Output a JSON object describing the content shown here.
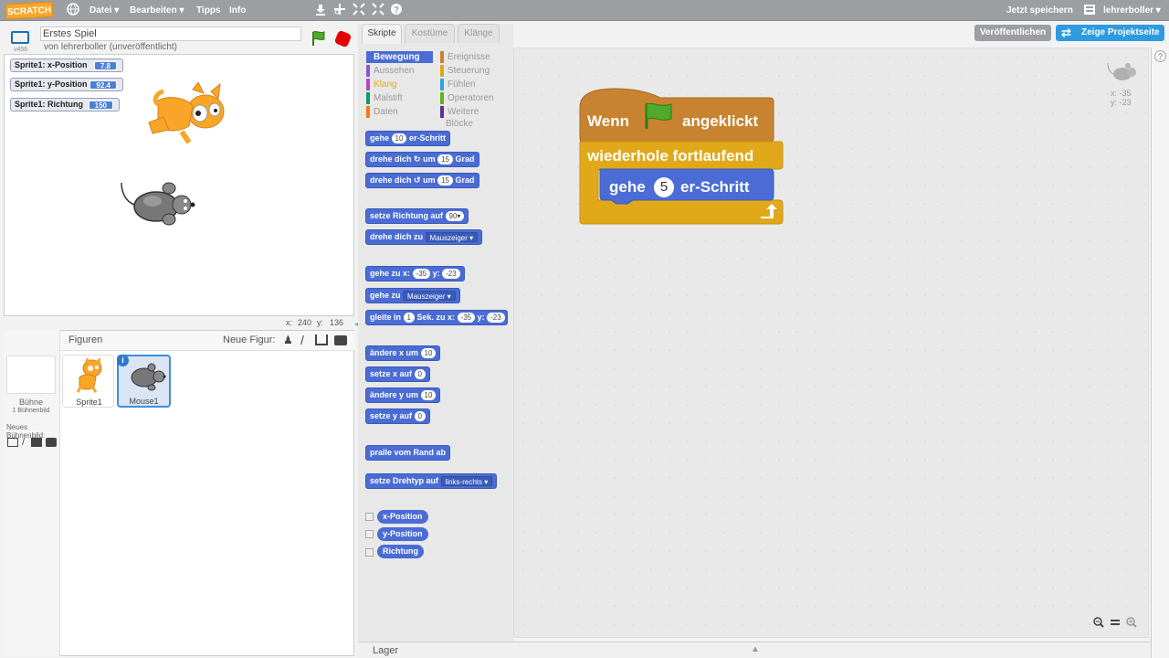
{
  "topbar": {
    "logo": "SCRATCH",
    "menu_file": "Datei ▾",
    "menu_edit": "Bearbeiten ▾",
    "menu_tips": "Tipps",
    "menu_info": "Info",
    "save_now": "Jetzt speichern",
    "username": "lehrerboller ▾",
    "icons": [
      "globe-icon",
      "duplicate-icon",
      "cut-icon",
      "grow-icon",
      "shrink-icon",
      "help-icon"
    ]
  },
  "stage_header": {
    "project_title": "Erstes Spiel",
    "byline": "von lehrerboller (unveröffentlicht)",
    "version": "v456"
  },
  "monitors": [
    {
      "label": "Sprite1: x-Position",
      "value": "7.8"
    },
    {
      "label": "Sprite1: y-Position",
      "value": "92.4"
    },
    {
      "label": "Sprite1: Richtung",
      "value": "150"
    }
  ],
  "stage_coords": {
    "x_label": "x:",
    "x_value": "240",
    "y_label": "y:",
    "y_value": "136"
  },
  "sprites_pane": {
    "title": "Figuren",
    "new_sprite": "Neue Figur:",
    "stage_label": "Bühne",
    "stage_sub": "1 Bühnenbild",
    "new_backdrop": "Neues Bühnenbild:",
    "sprites": [
      {
        "name": "Sprite1"
      },
      {
        "name": "Mouse1"
      }
    ]
  },
  "tabs": {
    "scripts": "Skripte",
    "costumes": "Kostüme",
    "sounds": "Klänge"
  },
  "categories": [
    {
      "label": "Bewegung",
      "color": "#4a6cd4"
    },
    {
      "label": "Ereignisse",
      "color": "#c88330"
    },
    {
      "label": "Aussehen",
      "color": "#8a55d7"
    },
    {
      "label": "Steuerung",
      "color": "#e1a91a"
    },
    {
      "label": "Klang",
      "color": "#bb42c3"
    },
    {
      "label": "Fühlen",
      "color": "#2ca5e2"
    },
    {
      "label": "Malstift",
      "color": "#0e9a6c"
    },
    {
      "label": "Operatoren",
      "color": "#5cb712"
    },
    {
      "label": "Daten",
      "color": "#ee7d16"
    },
    {
      "label": "Weitere Blöcke",
      "color": "#632d99"
    }
  ],
  "palette": {
    "b1": {
      "pre": "gehe",
      "v": "10",
      "post": "er-Schritt"
    },
    "b2": {
      "pre": "drehe dich",
      "v": "15",
      "mid": "um",
      "post": "Grad"
    },
    "b3": {
      "pre": "drehe dich",
      "v": "15",
      "mid": "um",
      "post": "Grad"
    },
    "b4": {
      "pre": "setze Richtung auf",
      "v": "90▾"
    },
    "b5": {
      "pre": "drehe dich zu",
      "v": "Mauszeiger ▾"
    },
    "b6": {
      "pre": "gehe zu x:",
      "v1": "-35",
      "mid": "y:",
      "v2": "-23"
    },
    "b7": {
      "pre": "gehe zu",
      "v": "Mauszeiger ▾"
    },
    "b8": {
      "pre": "gleite in",
      "v1": "1",
      "mid": "Sek. zu x:",
      "v2": "-35",
      "mid2": "y:",
      "v3": "-23"
    },
    "b9": {
      "pre": "ändere x um",
      "v": "10"
    },
    "b10": {
      "pre": "setze x auf",
      "v": "0"
    },
    "b11": {
      "pre": "ändere y um",
      "v": "10"
    },
    "b12": {
      "pre": "setze y auf",
      "v": "0"
    },
    "b13": {
      "pre": "pralle vom Rand ab"
    },
    "b14": {
      "pre": "setze Drehtyp auf",
      "v": "links-rechts ▾"
    },
    "r1": "x-Position",
    "r2": "y-Position",
    "r3": "Richtung"
  },
  "script": {
    "hat_when": "Wenn",
    "hat_clicked": "angeklickt",
    "forever": "wiederhole fortlaufend",
    "move_pre": "gehe",
    "move_value": "5",
    "move_post": "er-Schritt"
  },
  "script_info": {
    "x": "x: -35",
    "y": "y: -23"
  },
  "header_buttons": {
    "publish": "Veröffentlichen",
    "project_page": "Zeige Projektseite"
  },
  "lager": "Lager"
}
